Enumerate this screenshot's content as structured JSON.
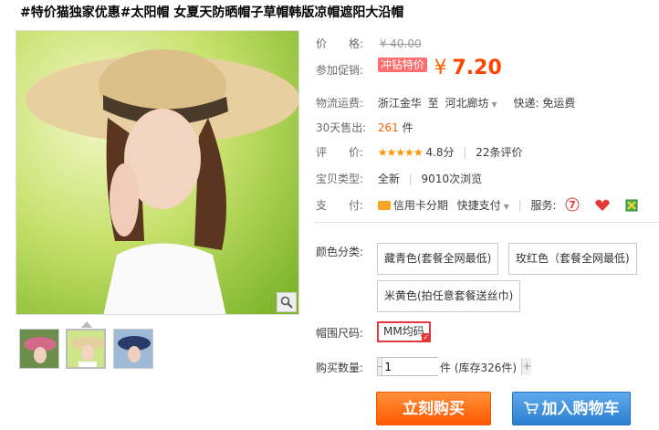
{
  "title": "#特价猫独家优惠#太阳帽 女夏天防晒帽子草帽韩版凉帽遮阳大沿帽",
  "price": {
    "label": "价　　格:",
    "original": "¥ 40.00"
  },
  "promo": {
    "label": "参加促销:",
    "tag": "冲钻特价",
    "currency": "¥",
    "value": "7.20"
  },
  "shipping": {
    "label": "物流运费:",
    "from": "浙江金华",
    "to_prefix": "至",
    "to": "河北廊坊",
    "fee": "快递: 免运费"
  },
  "sales": {
    "label": "30天售出:",
    "count": "261",
    "unit": "件"
  },
  "rating": {
    "label": "评　　价:",
    "stars": "★★★★★",
    "score": "4.8分",
    "reviews": "22条评价"
  },
  "item_type": {
    "label": "宝贝类型:",
    "condition": "全新",
    "views": "9010次浏览"
  },
  "payment": {
    "label": "支　　付:",
    "installment": "信用卡分期",
    "quick_pay": "快捷支付",
    "service_label": "服务:"
  },
  "color": {
    "label": "颜色分类:",
    "options": [
      "藏青色(套餐全网最低)",
      "玫红色（套餐全网最低)",
      "米黄色(拍任意套餐送丝巾)"
    ]
  },
  "size": {
    "label": "帽围尺码:",
    "options": [
      "MM均码"
    ]
  },
  "quantity": {
    "label": "购买数量:",
    "value": "1",
    "unit": "件",
    "stock": "(库存326件)"
  },
  "actions": {
    "buy": "立刻购买",
    "cart": "加入购物车"
  },
  "colors": {
    "accent": "#ff4400",
    "buy": "#ff6a00",
    "cart": "#3a8ee6"
  }
}
